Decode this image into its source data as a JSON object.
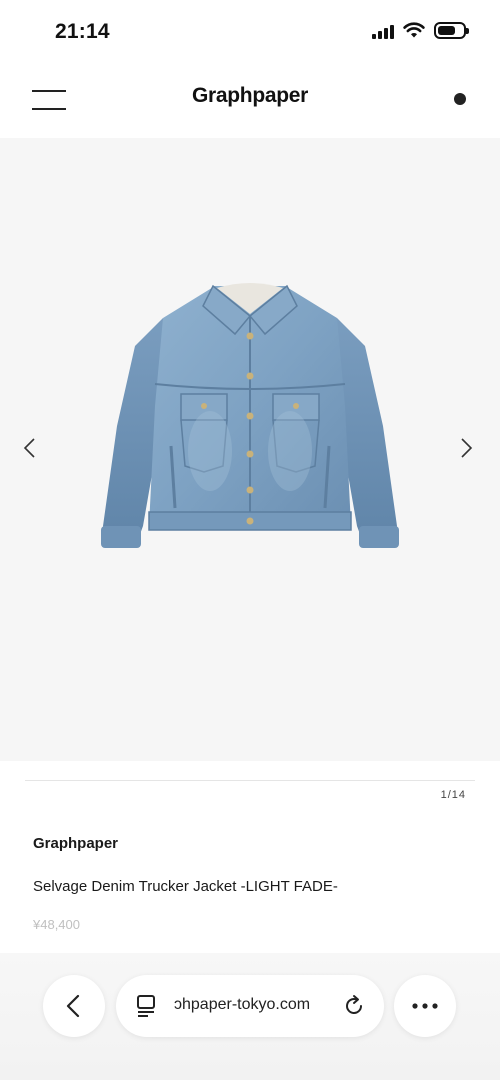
{
  "status_bar": {
    "time": "21:14",
    "icons": [
      "cellular-signal-icon",
      "wifi-icon",
      "battery-icon"
    ]
  },
  "header": {
    "brand": "Graphpaper",
    "left_icon": "hamburger-menu-icon",
    "right_icon": "cart-dot-icon"
  },
  "gallery": {
    "counter": "1/14",
    "prev_icon": "chevron-left-icon",
    "next_icon": "chevron-right-icon",
    "image": "denim-jacket-image"
  },
  "product": {
    "brand": "Graphpaper",
    "name": "Selvage Denim Trucker Jacket -LIGHT FADE-",
    "price": "¥48,400"
  },
  "browser": {
    "url": "ɔhpaper-tokyo.com",
    "back_icon": "back-chevron-icon",
    "page_icon": "page-menu-icon",
    "reload_icon": "reload-icon",
    "more_icon": "more-dots-icon"
  },
  "colors": {
    "gallery_bg": "#f6f6f6",
    "denim": "#7fa3c4",
    "price": "#c0c0c0"
  }
}
